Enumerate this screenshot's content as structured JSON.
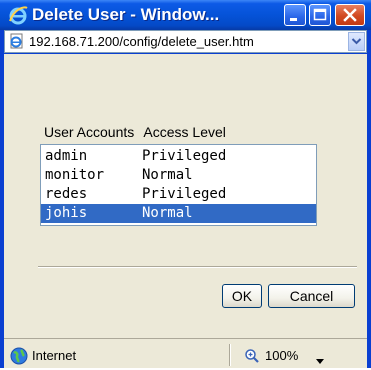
{
  "window": {
    "title": "Delete User - Window..."
  },
  "address_bar": {
    "url": "192.168.71.200/config/delete_user.htm"
  },
  "user_list": {
    "header_accounts": "User Accounts",
    "header_access": "Access Level",
    "rows": [
      {
        "account": "admin",
        "access": "Privileged",
        "selected": false
      },
      {
        "account": "monitor",
        "access": "Normal",
        "selected": false
      },
      {
        "account": "redes",
        "access": "Privileged",
        "selected": false
      },
      {
        "account": "johis",
        "access": "Normal",
        "selected": true
      }
    ]
  },
  "buttons": {
    "ok_label": "OK",
    "cancel_label": "Cancel"
  },
  "status_bar": {
    "zone": "Internet",
    "zoom": "100%"
  },
  "colors": {
    "titlebar": "#0553d8",
    "selection": "#316ac5",
    "dialog_bg": "#ece9d8",
    "close_button": "#d14a22"
  },
  "icons": {
    "title": "ie-logo-icon",
    "address": "page-icon",
    "status_zone": "globe-icon",
    "zoom": "magnifier-icon"
  }
}
